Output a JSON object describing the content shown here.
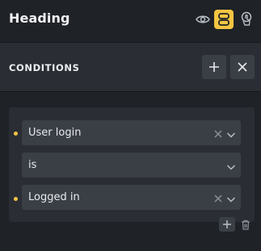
{
  "header": {
    "title": "Heading"
  },
  "conditions": {
    "title": "CONDITIONS",
    "rows": [
      {
        "value": "User login",
        "clearable": true,
        "marked": true
      },
      {
        "value": "is",
        "clearable": false,
        "marked": false
      },
      {
        "value": "Logged in",
        "clearable": true,
        "marked": true
      }
    ]
  },
  "colors": {
    "accent": "#f5c542",
    "background": "#1f2227",
    "panel": "#2a2e34",
    "field": "#3a3f46"
  },
  "icons": {
    "header": [
      "eye-icon",
      "stack-icon",
      "touch-icon"
    ],
    "section": [
      "plus-icon",
      "close-icon"
    ],
    "footer": [
      "plus-icon",
      "trash-icon"
    ]
  }
}
